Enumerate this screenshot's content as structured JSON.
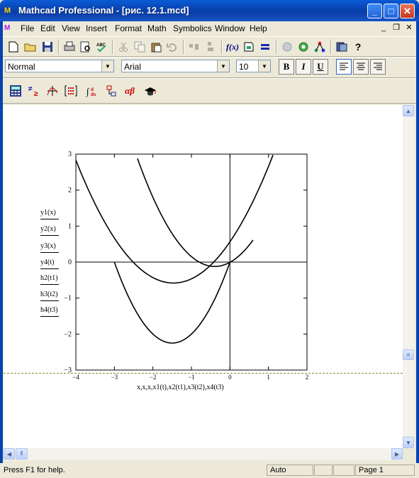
{
  "window": {
    "title": "Mathcad Professional - [рис. 12.1.mcd]",
    "app_icon_glyph": "M",
    "minimize_glyph": "_",
    "maximize_glyph": "□",
    "close_glyph": "✕"
  },
  "menubar": {
    "items": [
      "File",
      "Edit",
      "View",
      "Insert",
      "Format",
      "Math",
      "Symbolics",
      "Window",
      "Help"
    ],
    "mdi_minimize": "_",
    "mdi_restore": "❐",
    "mdi_close": "✕"
  },
  "format_toolbar": {
    "style_value": "Normal",
    "font_value": "Arial",
    "size_value": "10",
    "bold_label": "B",
    "italic_label": "I",
    "underline_label": "U"
  },
  "plot": {
    "legend": [
      "y1(x)",
      "y2(x)",
      "y3(x)",
      "y4(t)",
      "h2(t1)",
      "h3(t2)",
      "h4(t3)"
    ],
    "x_axis_label": "x,x,x,x1(t),x2(t1),x3(t2),x4(t3)",
    "y_ticks": [
      "3",
      "2",
      "1",
      "0",
      "−1",
      "−2",
      "−3"
    ],
    "x_ticks": [
      "−4",
      "−3",
      "−2",
      "−1",
      "0",
      "1",
      "2"
    ]
  },
  "chart_data": {
    "type": "line",
    "xlabel": "x,x,x,x1(t),x2(t1),x3(t2),x4(t3)",
    "ylabel": "y1(x), y2(x), y3(x), y4(t), h2(t1), h3(t2), h4(t3)",
    "xlim": [
      -4,
      2
    ],
    "ylim": [
      -3,
      3
    ],
    "grid": false,
    "series": [
      {
        "name": "y1(x)",
        "x": [
          -3.0,
          -2.5,
          -2.0,
          -1.5,
          -1.0,
          -0.5,
          0.0
        ],
        "y": [
          0.0,
          -1.25,
          -2.0,
          -2.25,
          -2.0,
          -1.25,
          0.0
        ]
      },
      {
        "name": "y2(x)",
        "x": [
          -2.4,
          -2.0,
          -1.6,
          -1.2,
          -0.8,
          -0.4,
          0.0,
          0.4,
          0.6
        ],
        "y": [
          2.88,
          1.8,
          0.96,
          0.36,
          0.0,
          -0.12,
          0.0,
          0.36,
          0.6
        ]
      },
      {
        "name": "y3(x)",
        "x": [
          -4.0,
          -3.5,
          -3.0,
          -2.5,
          -2.0,
          -1.5,
          -1.0,
          -0.5,
          0.0,
          0.5,
          1.0,
          1.25
        ],
        "y": [
          2.88,
          1.64,
          0.66,
          -0.06,
          -0.5,
          -0.66,
          -0.5,
          -0.06,
          0.66,
          1.64,
          2.88,
          3.0
        ]
      }
    ]
  }
}
